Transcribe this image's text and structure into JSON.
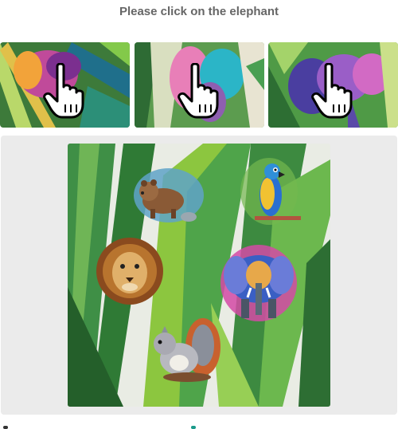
{
  "prompt": {
    "text": "Please click on the elephant"
  },
  "colors": {
    "title": "#666666",
    "panel": "#ebebeb",
    "leaf_dark": "#2f7a35",
    "leaf_light": "#8cc63f",
    "accent": "#1a9a8a"
  },
  "options": [
    {
      "id": "option-1",
      "icon": "hand-pointer-cursor"
    },
    {
      "id": "option-2",
      "icon": "hand-pointer-cursor"
    },
    {
      "id": "option-3",
      "icon": "hand-pointer-cursor"
    }
  ],
  "scene": {
    "animals": [
      "bear",
      "parrot",
      "lion",
      "elephant",
      "squirrel"
    ]
  }
}
